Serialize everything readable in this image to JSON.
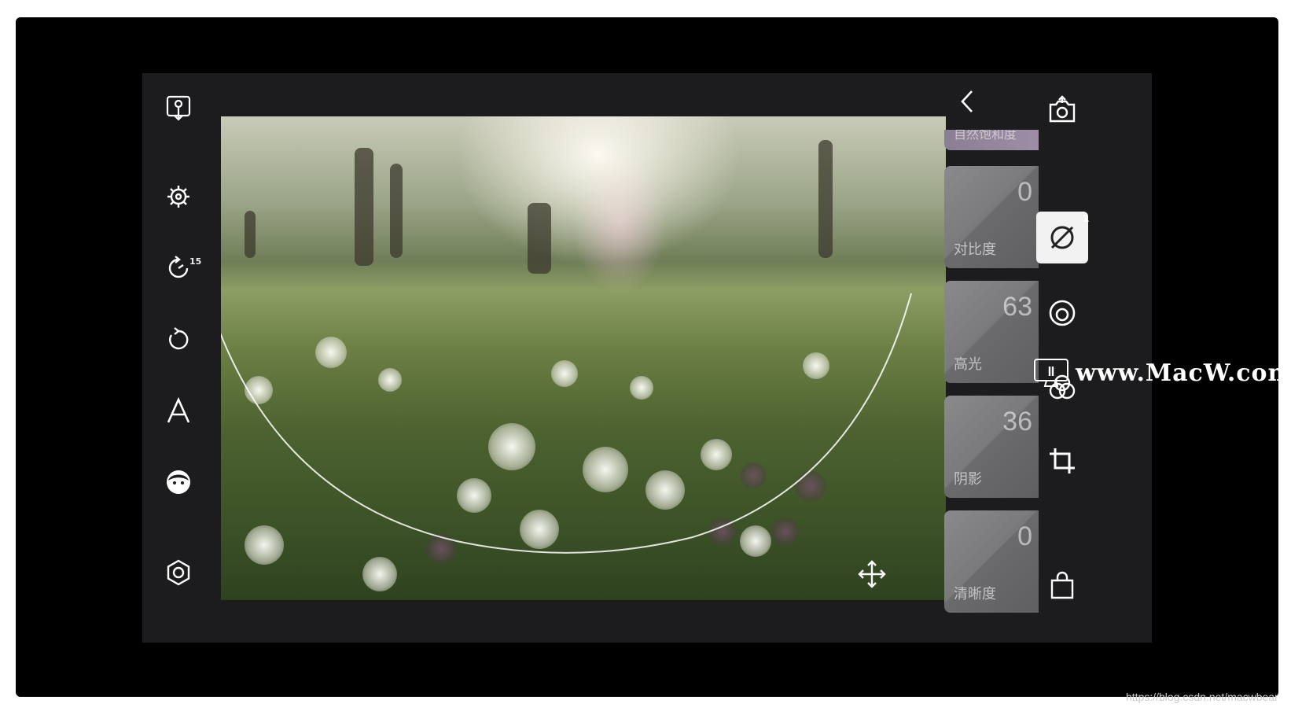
{
  "left_toolbar": {
    "icons": [
      "export-icon",
      "settings-icon",
      "timer-icon",
      "undo-icon",
      "text-icon",
      "face-icon",
      "hexagon-icon"
    ],
    "timer_badge": "15"
  },
  "right_toolbar": {
    "back_icon": "chevron-left-icon",
    "icons": [
      "camera-switch-icon",
      "healing-brush-icon",
      "vignette-icon",
      "color-filter-icon",
      "crop-icon",
      "shopping-bag-icon"
    ],
    "active_badge": "1"
  },
  "adjustments": {
    "partial_top_label": "自然饱和度",
    "items": [
      {
        "label": "对比度",
        "value": "0"
      },
      {
        "label": "高光",
        "value": "63"
      },
      {
        "label": "阴影",
        "value": "36"
      },
      {
        "label": "清晰度",
        "value": "0"
      }
    ]
  },
  "watermark": {
    "text": "www.MacW.com"
  },
  "credit": "https://blog.csdn.net/macwbear"
}
